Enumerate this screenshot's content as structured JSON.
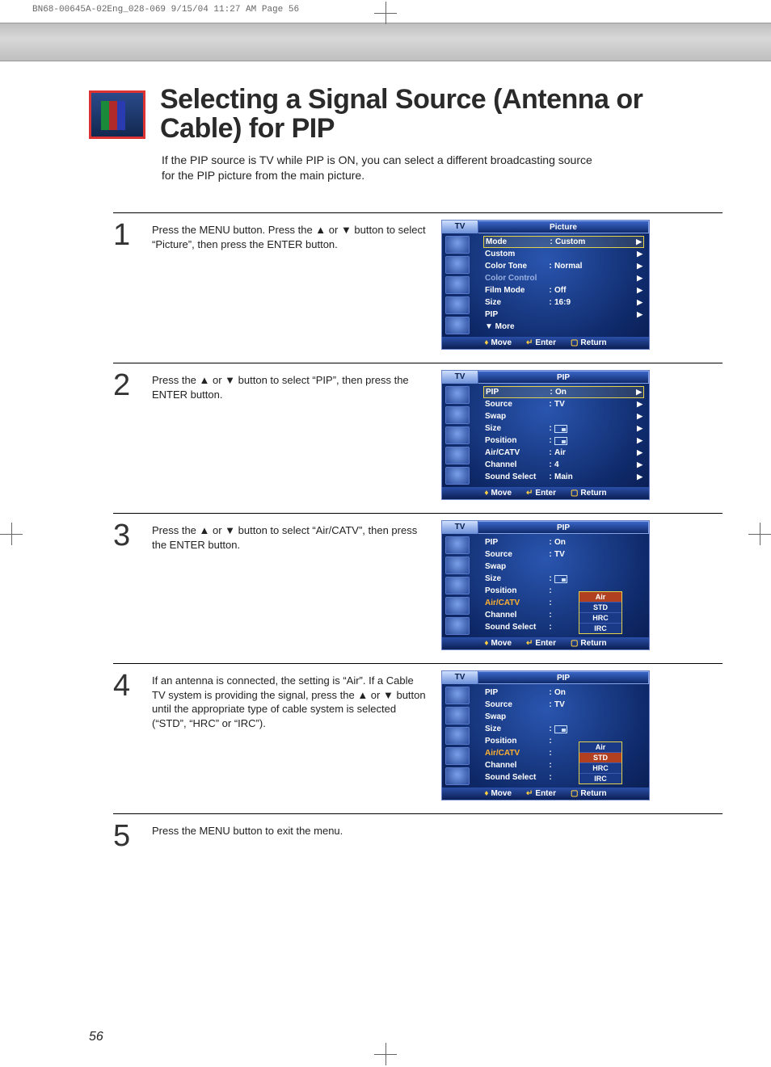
{
  "doc_header": "BN68-00645A-02Eng_028-069  9/15/04  11:27 AM  Page 56",
  "title": "Selecting a Signal Source (Antenna or Cable) for PIP",
  "lead": "If the PIP source is TV while PIP is ON, you can select a different broadcasting source for the PIP picture from the main picture.",
  "page_number": "56",
  "steps": {
    "s1": {
      "num": "1",
      "text": "Press the MENU button. Press the ▲ or ▼ button to select “Picture”, then press the ENTER button."
    },
    "s2": {
      "num": "2",
      "text": "Press the ▲ or ▼ button to select “PIP”, then press the ENTER button."
    },
    "s3": {
      "num": "3",
      "text": "Press the ▲ or ▼ button to select “Air/CATV”, then press the ENTER button."
    },
    "s4": {
      "num": "4",
      "text": "If an antenna is connected, the setting is “Air”. If a Cable TV system is providing the signal, press the ▲ or ▼ button until the appropriate type of cable system is selected (“STD”, “HRC” or “IRC”)."
    },
    "s5": {
      "num": "5",
      "text": "Press the MENU button to exit the menu."
    }
  },
  "osd_common": {
    "tab": "TV",
    "foot_move": "Move",
    "foot_enter": "Enter",
    "foot_return": "Return"
  },
  "osd1": {
    "title": "Picture",
    "rows": [
      {
        "lab": "Mode",
        "val": "Custom",
        "sel": true,
        "muted": false,
        "caret": "▶"
      },
      {
        "lab": "Custom",
        "val": "",
        "sel": false,
        "muted": false,
        "caret": "▶"
      },
      {
        "lab": "Color Tone",
        "val": "Normal",
        "sel": false,
        "muted": false,
        "caret": "▶"
      },
      {
        "lab": "Color Control",
        "val": "",
        "sel": false,
        "muted": true,
        "caret": "▶"
      },
      {
        "lab": "Film Mode",
        "val": "Off",
        "sel": false,
        "muted": false,
        "caret": "▶"
      },
      {
        "lab": "Size",
        "val": "16:9",
        "sel": false,
        "muted": false,
        "caret": "▶"
      },
      {
        "lab": "PIP",
        "val": "",
        "sel": false,
        "muted": false,
        "caret": "▶"
      },
      {
        "lab": "▼ More",
        "val": "",
        "sel": false,
        "muted": false,
        "caret": ""
      }
    ]
  },
  "osd2": {
    "title": "PIP",
    "rows": [
      {
        "lab": "PIP",
        "val": "On",
        "sel": true,
        "caret": "▶"
      },
      {
        "lab": "Source",
        "val": "TV",
        "sel": false,
        "caret": "▶"
      },
      {
        "lab": "Swap",
        "val": "",
        "sel": false,
        "caret": "▶"
      },
      {
        "lab": "Size",
        "val": "icon",
        "sel": false,
        "caret": "▶"
      },
      {
        "lab": "Position",
        "val": "icon",
        "sel": false,
        "caret": "▶"
      },
      {
        "lab": "Air/CATV",
        "val": "Air",
        "sel": false,
        "caret": "▶"
      },
      {
        "lab": "Channel",
        "val": "4",
        "sel": false,
        "caret": "▶"
      },
      {
        "lab": "Sound Select",
        "val": "Main",
        "sel": false,
        "caret": "▶"
      }
    ]
  },
  "osd3": {
    "title": "PIP",
    "rows": [
      {
        "lab": "PIP",
        "val": "On"
      },
      {
        "lab": "Source",
        "val": "TV"
      },
      {
        "lab": "Swap",
        "val": ""
      },
      {
        "lab": "Size",
        "val": "icon"
      },
      {
        "lab": "Position",
        "val": "",
        "hl": false
      },
      {
        "lab": "Air/CATV",
        "val": "",
        "hl": true
      },
      {
        "lab": "Channel",
        "val": ""
      },
      {
        "lab": "Sound Select",
        "val": ""
      }
    ],
    "options": [
      "Air",
      "STD",
      "HRC",
      "IRC"
    ],
    "selected": "Air"
  },
  "osd4": {
    "title": "PIP",
    "rows": [
      {
        "lab": "PIP",
        "val": "On"
      },
      {
        "lab": "Source",
        "val": "TV"
      },
      {
        "lab": "Swap",
        "val": ""
      },
      {
        "lab": "Size",
        "val": "icon"
      },
      {
        "lab": "Position",
        "val": "",
        "hl": false
      },
      {
        "lab": "Air/CATV",
        "val": "",
        "hl": true
      },
      {
        "lab": "Channel",
        "val": ""
      },
      {
        "lab": "Sound Select",
        "val": ""
      }
    ],
    "options": [
      "Air",
      "STD",
      "HRC",
      "IRC"
    ],
    "selected": "STD"
  }
}
